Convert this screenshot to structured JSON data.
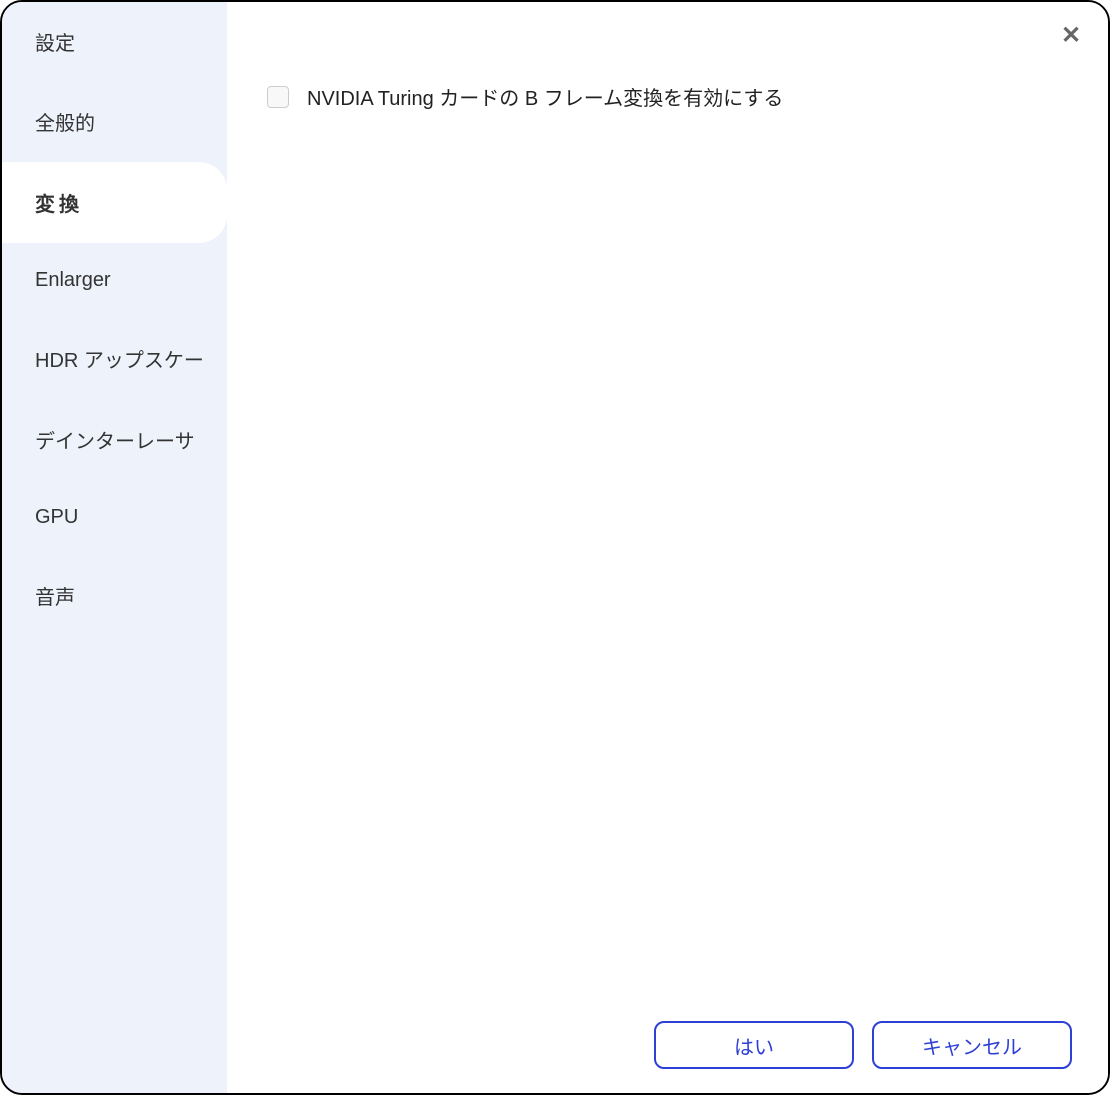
{
  "sidebar": {
    "title": "設定",
    "items": [
      {
        "label": "全般的",
        "active": false
      },
      {
        "label": "変換",
        "active": true
      },
      {
        "label": "Enlarger",
        "active": false
      },
      {
        "label": "HDR アップスケー",
        "active": false
      },
      {
        "label": "デインターレーサ",
        "active": false
      },
      {
        "label": "GPU",
        "active": false
      },
      {
        "label": "音声",
        "active": false
      }
    ]
  },
  "main": {
    "checkbox_label": "NVIDIA Turing カードの B フレーム変換を有効にする",
    "checkbox_checked": false
  },
  "footer": {
    "ok_label": "はい",
    "cancel_label": "キャンセル"
  },
  "close_icon": "✕"
}
